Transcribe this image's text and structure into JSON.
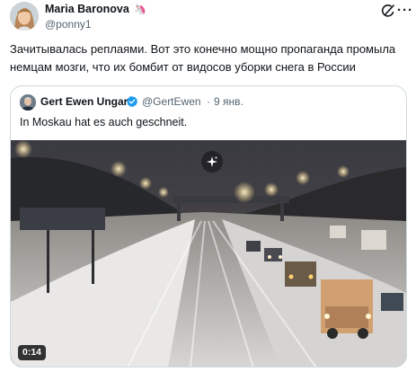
{
  "post": {
    "author_name": "Maria Baronova",
    "author_emoji": "🦄",
    "handle": "@ponny1",
    "text": "Зачитывалась реплаями. Вот это конечно мощно пропаганда промыла немцам мозги, что их бомбит от видосов уборки снега в России",
    "icons": {
      "grok": "grok-slash-icon",
      "more": "more-dots-icon"
    }
  },
  "quote": {
    "author_name": "Gert Ewen Ungar",
    "verified_icon": "verified-badge-icon",
    "handle": "@GertEwen",
    "separator": "·",
    "date": "9 янв.",
    "text": "In Moskau hat es auch geschneit.",
    "video": {
      "duration": "0:14",
      "overlay_icon": "sparkle-icon"
    }
  },
  "colors": {
    "text": "#0f1419",
    "secondary": "#536471",
    "verified": "#1d9bf0",
    "border": "#cfd9de"
  }
}
